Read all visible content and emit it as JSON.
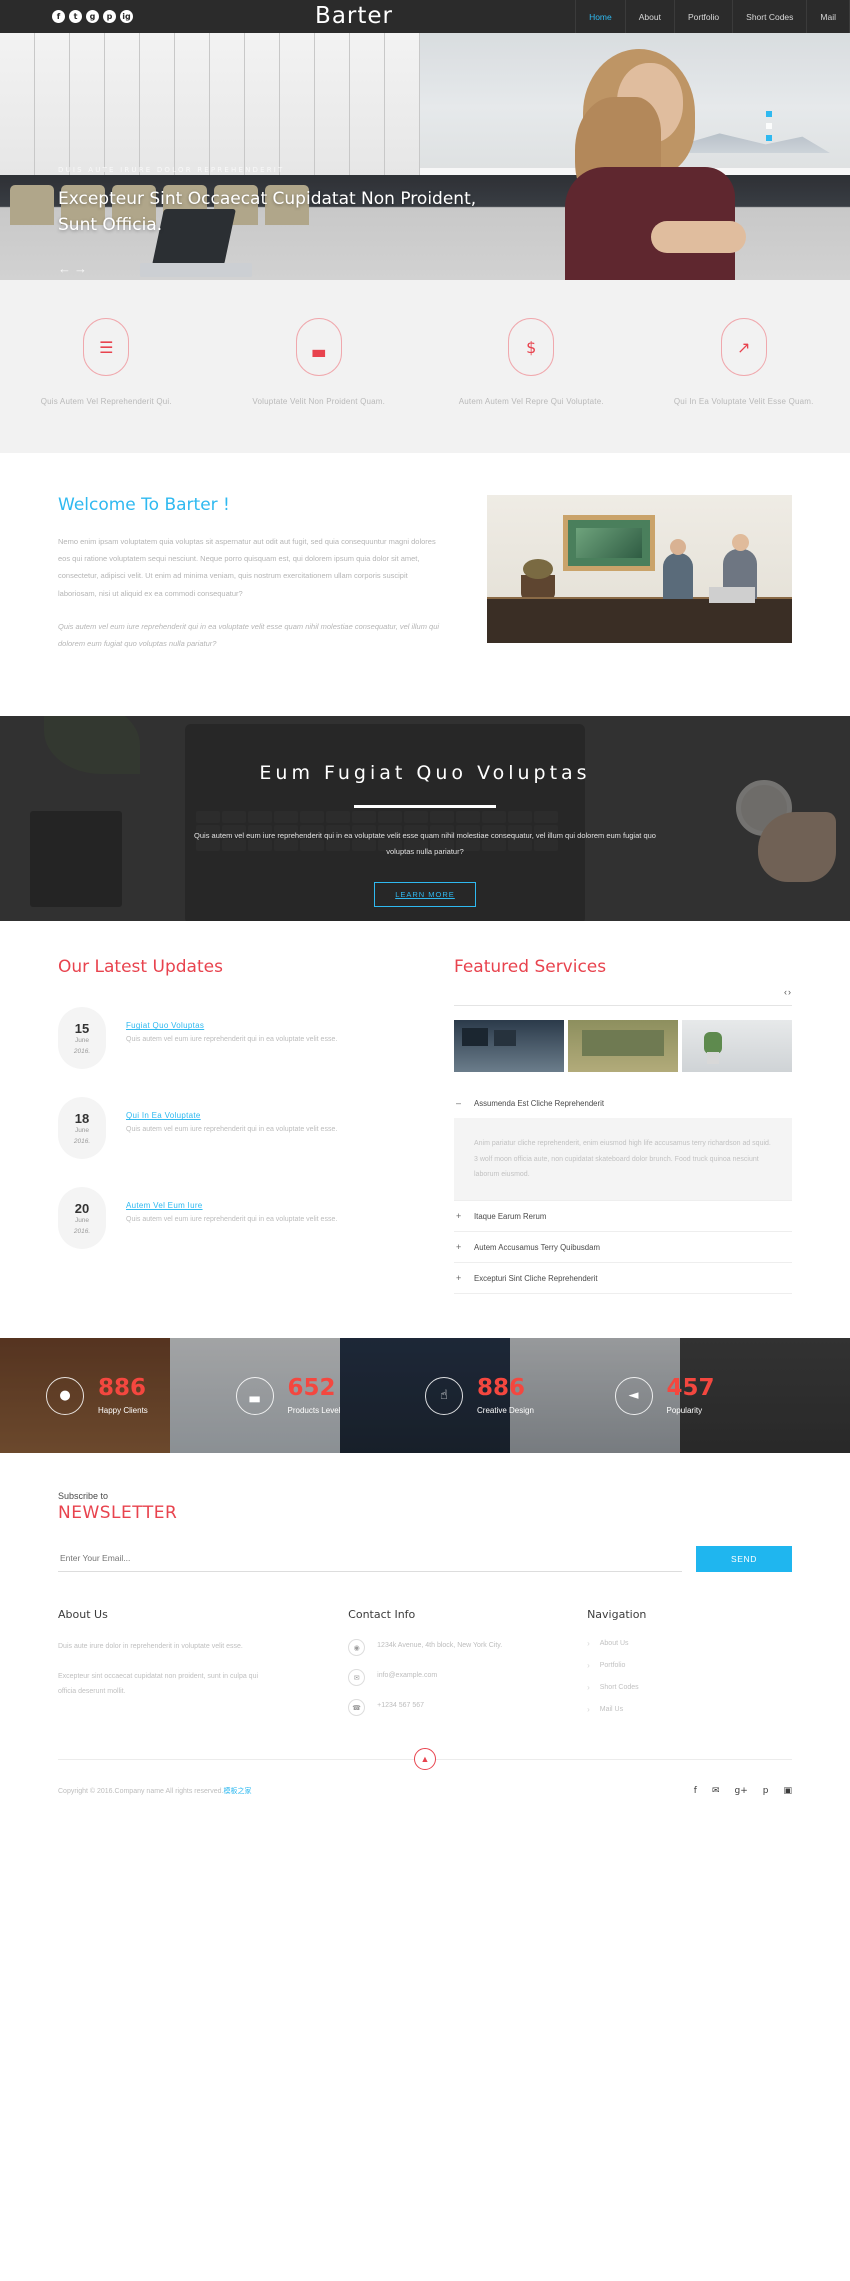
{
  "header": {
    "logo": "Barter",
    "social": [
      {
        "name": "facebook-icon",
        "glyph": "f"
      },
      {
        "name": "twitter-icon",
        "glyph": "t"
      },
      {
        "name": "google-plus-icon",
        "glyph": "g"
      },
      {
        "name": "pinterest-icon",
        "glyph": "p"
      },
      {
        "name": "instagram-icon",
        "glyph": "ig"
      }
    ],
    "nav": [
      {
        "label": "Home",
        "active": true
      },
      {
        "label": "About",
        "active": false
      },
      {
        "label": "Portfolio",
        "active": false
      },
      {
        "label": "Short Codes",
        "active": false
      },
      {
        "label": "Mail",
        "active": false
      }
    ]
  },
  "hero": {
    "kicker": "Duis Aute Irure Dolor Reprehenderit",
    "title": "Excepteur Sint Occaecat Cupidatat Non Proident, Sunt Officia.",
    "arrows": "←→",
    "accent": "#2fb9f0"
  },
  "features": [
    {
      "icon": "list-icon",
      "glyph": "☰",
      "text": "Quis Autem Vel Reprehenderit Qui."
    },
    {
      "icon": "bar-chart-icon",
      "glyph": "▃",
      "text": "Voluptate Velit Non Proident Quam."
    },
    {
      "icon": "dollar-icon",
      "glyph": "$",
      "text": "Autem Autem Vel Repre Qui Voluptate."
    },
    {
      "icon": "rocket-icon",
      "glyph": "↗",
      "text": "Qui In Ea Voluptate Velit Esse Quam."
    }
  ],
  "welcome": {
    "heading": "Welcome To Barter !",
    "p1": "Nemo enim ipsam voluptatem quia voluptas sit aspernatur aut odit aut fugit, sed quia consequuntur magni dolores eos qui ratione voluptatem sequi nesciunt. Neque porro quisquam est, qui dolorem ipsum quia dolor sit amet, consectetur, adipisci velit. Ut enim ad minima veniam, quis nostrum exercitationem ullam corporis suscipit laboriosam, nisi ut aliquid ex ea commodi consequatur?",
    "p2": "Quis autem vel eum iure reprehenderit qui in ea voluptate velit esse quam nihil molestiae consequatur, vel illum qui dolorem eum fugiat quo voluptas nulla pariatur?"
  },
  "parallax": {
    "title": "Eum Fugiat Quo Voluptas",
    "text": "Quis autem vel eum iure reprehenderit qui in ea voluptate velit esse quam nihil molestiae consequatur, vel illum qui dolorem eum fugiat quo voluptas nulla pariatur?",
    "button": "LEARN MORE"
  },
  "updates": {
    "heading_a": "Our Latest ",
    "heading_b": "Updates",
    "items": [
      {
        "day": "15",
        "month": "June",
        "year": "2016.",
        "title": "Fugiat Quo Voluptas",
        "text": "Quis autem vel eum iure reprehenderit qui in ea voluptate velit esse."
      },
      {
        "day": "18",
        "month": "June",
        "year": "2016.",
        "title": "Qui In Ea Voluptate",
        "text": "Quis autem vel eum iure reprehenderit qui in ea voluptate velit esse."
      },
      {
        "day": "20",
        "month": "June",
        "year": "2016.",
        "title": "Autem Vel Eum Iure",
        "text": "Quis autem vel eum iure reprehenderit qui in ea voluptate velit esse."
      }
    ]
  },
  "services": {
    "heading_a": "Featured ",
    "heading_b": "Services",
    "prev": "‹",
    "next": "›",
    "accordion": [
      {
        "sign": "–",
        "title": "Assumenda Est Cliche Reprehenderit",
        "open": true,
        "body": "Anim pariatur cliche reprehenderit, enim eiusmod high life accusamus terry richardson ad squid. 3 wolf moon officia aute, non cupidatat skateboard dolor brunch. Food truck quinoa nesciunt laborum eiusmod."
      },
      {
        "sign": "+",
        "title": "Itaque Earum Rerum",
        "open": false,
        "body": ""
      },
      {
        "sign": "+",
        "title": "Autem Accusamus Terry Quibusdam",
        "open": false,
        "body": ""
      },
      {
        "sign": "+",
        "title": "Excepturi Sint Cliche Reprehenderit",
        "open": false,
        "body": ""
      }
    ]
  },
  "counters": [
    {
      "icon": "user-icon",
      "glyph": "●",
      "number": "886",
      "label": "Happy Clients"
    },
    {
      "icon": "bar-chart-icon",
      "glyph": "▃",
      "number": "652",
      "label": "Products Level"
    },
    {
      "icon": "thumbs-up-icon",
      "glyph": "☝",
      "number": "886",
      "label": "Creative Design"
    },
    {
      "icon": "megaphone-icon",
      "glyph": "◄",
      "number": "457",
      "label": "Popularity"
    }
  ],
  "newsletter": {
    "sub": "Subscribe to",
    "heading": "NEWSLETTER",
    "placeholder": "Enter Your Email...",
    "button": "SEND"
  },
  "footer": {
    "about": {
      "heading": "About Us",
      "p1": "Duis aute irure dolor in reprehenderit in voluptate velit esse.",
      "p2": "Excepteur sint occaecat cupidatat non proident, sunt in culpa qui officia deserunt mollit."
    },
    "contact": {
      "heading": "Contact Info",
      "items": [
        {
          "icon": "location-pin-icon",
          "glyph": "◉",
          "text": "1234k Avenue, 4th block, New York City."
        },
        {
          "icon": "envelope-icon",
          "glyph": "✉",
          "text": "info@example.com"
        },
        {
          "icon": "phone-icon",
          "glyph": "☎",
          "text": "+1234 567 567"
        }
      ]
    },
    "navigation": {
      "heading": "Navigation",
      "links": [
        "About Us",
        "Portfolio",
        "Short Codes",
        "Mail Us"
      ]
    },
    "copyright_a": "Copyright © 2016.Company name All rights reserved.",
    "copyright_b": "模板之家",
    "social": [
      {
        "name": "facebook-icon",
        "glyph": "f"
      },
      {
        "name": "twitter-icon",
        "glyph": "✉"
      },
      {
        "name": "google-plus-icon",
        "glyph": "g+"
      },
      {
        "name": "pinterest-icon",
        "glyph": "p"
      },
      {
        "name": "instagram-icon",
        "glyph": "▣"
      }
    ],
    "to_top": "▲"
  }
}
